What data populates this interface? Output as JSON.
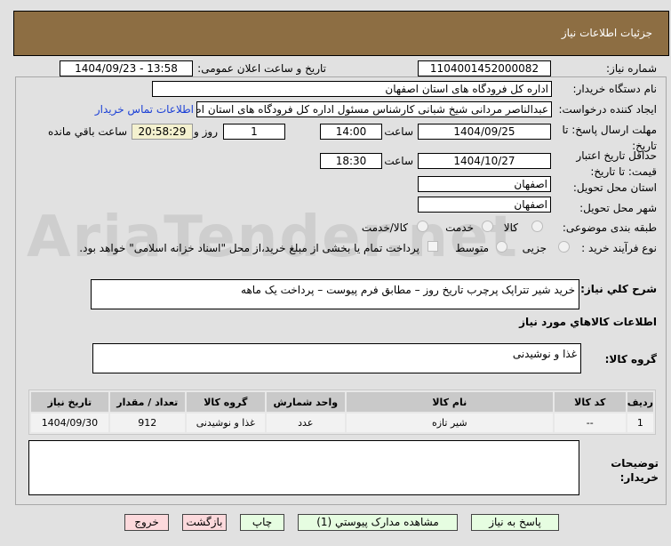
{
  "header": {
    "title": "جزئیات اطلاعات نیاز"
  },
  "form": {
    "need_number_label": "شماره نیاز:",
    "need_number": "1104001452000082",
    "announce_label": "تاریخ و ساعت اعلان عمومی:",
    "announce_value": "1404/09/23 - 13:58",
    "buyer_label": "نام دستگاه خریدار:",
    "buyer_value": "اداره کل فرودگاه های استان اصفهان",
    "creator_label": "ایجاد کننده درخواست:",
    "creator_value": "عبدالناصر مردانی شیخ شبانی کارشناس مسئول  اداره کل فرودگاه های استان اصفهان",
    "contact_link": "اطلاعات تماس خریدار",
    "deadline_label": "مهلت ارسال پاسخ: تا تاریخ:",
    "deadline_date": "1404/09/25",
    "time_label": "ساعت",
    "deadline_time": "14:00",
    "days": "1",
    "days_label": "روز و",
    "remaining": "20:58:29",
    "remaining_label": "ساعت باقي مانده",
    "validity_label": "حداقل تاریخ اعتبار قیمت: تا تاریخ:",
    "validity_date": "1404/10/27",
    "validity_time": "18:30",
    "province_label": "استان محل تحویل:",
    "province": "اصفهان",
    "city_label": "شهر محل تحویل:",
    "city": "اصفهان",
    "category_label": "طبقه بندی موضوعی:",
    "category_options": [
      "کالا",
      "خدمت",
      "کالا/خدمت"
    ],
    "category_selected": "کالا",
    "process_label": "نوع فرآیند خرید :",
    "process_options": [
      "جزیی",
      "متوسط"
    ],
    "payment_note": "پرداخت تمام یا بخشی از مبلغ خرید،از محل \"اسناد خزانه اسلامی\" خواهد بود."
  },
  "description": {
    "label": "شرح كلي نیاز:",
    "value": "خرید شیر تتراپک پرچرب تاریخ روز  – مطابق فرم پیوست – پرداخت یک ماهه"
  },
  "goods": {
    "heading": "اطلاعات كالاهاي مورد نیاز",
    "group_label": "گروه کالا:",
    "group_value": "غذا و نوشیدنی",
    "columns": [
      "ردیف",
      "کد کالا",
      "نام کالا",
      "واحد شمارش",
      "گروه کالا",
      "تعداد / مقدار",
      "تاریخ نیاز"
    ],
    "rows": [
      [
        "1",
        "--",
        "شیر تازه",
        "عدد",
        "غذا و نوشیدنی",
        "912",
        "1404/09/30"
      ]
    ]
  },
  "notes": {
    "label": "توضیحات خریدار:",
    "value": ""
  },
  "buttons": {
    "reply": "پاسخ به نیاز",
    "attachments": "مشاهده مدارک پیوستي (1)",
    "print": "چاپ",
    "back": "بازگشت",
    "exit": "خروج"
  },
  "watermark": "AriaTender.net"
}
